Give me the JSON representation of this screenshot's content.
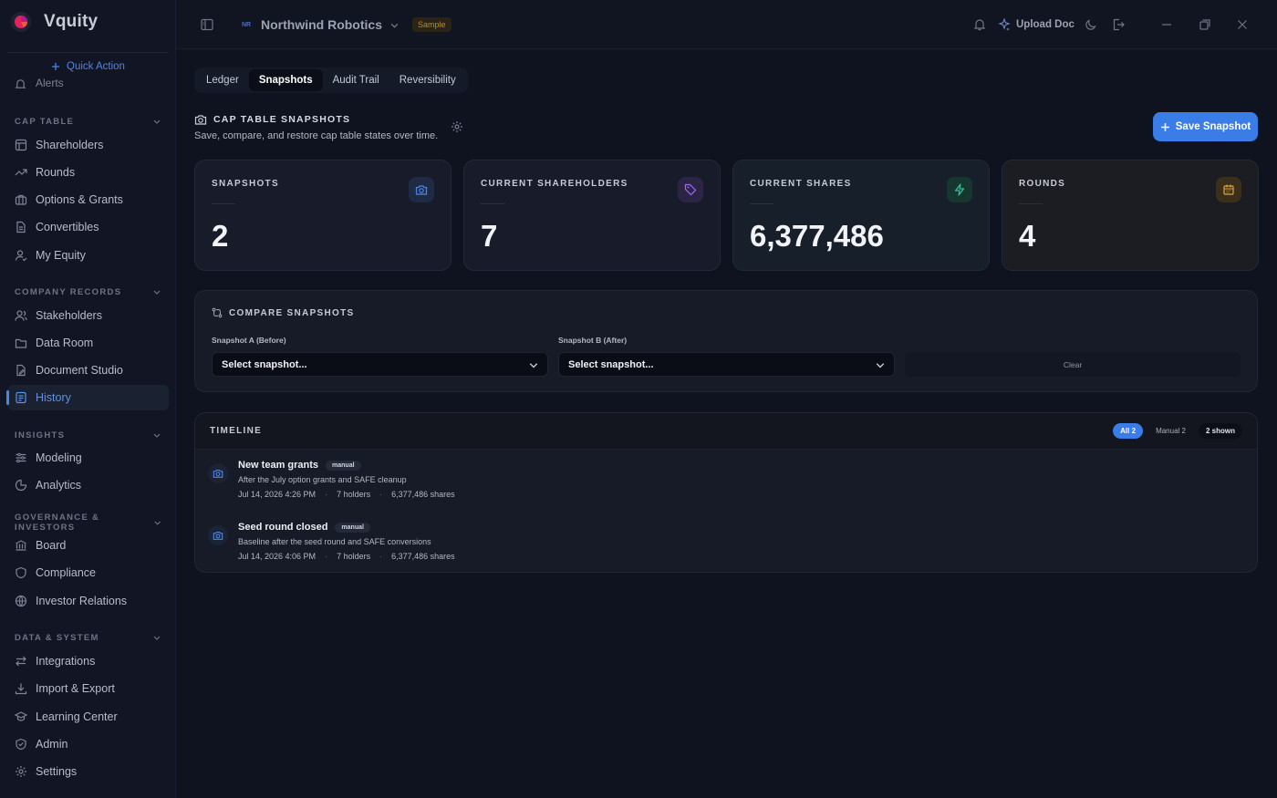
{
  "brand": {
    "name": "Vquity"
  },
  "sidebar": {
    "quick_action": "Quick Action",
    "alerts_peek": "Alerts",
    "sections": [
      {
        "title": "CAP TABLE",
        "items": [
          "Shareholders",
          "Rounds",
          "Options & Grants",
          "Convertibles",
          "My Equity"
        ]
      },
      {
        "title": "COMPANY RECORDS",
        "items": [
          "Stakeholders",
          "Data Room",
          "Document Studio",
          "History"
        ]
      },
      {
        "title": "INSIGHTS",
        "items": [
          "Modeling",
          "Analytics"
        ]
      },
      {
        "title": "GOVERNANCE & INVESTORS",
        "items": [
          "Board",
          "Compliance",
          "Investor Relations"
        ]
      },
      {
        "title": "DATA & SYSTEM",
        "items": [
          "Integrations",
          "Import & Export",
          "Learning Center",
          "Admin",
          "Settings"
        ]
      }
    ],
    "active_item": "History"
  },
  "topbar": {
    "company_initials": "NR",
    "company_name": "Northwind Robotics",
    "badge": "Sample",
    "upload_doc": "Upload Doc"
  },
  "tabs": [
    "Ledger",
    "Snapshots",
    "Audit Trail",
    "Reversibility"
  ],
  "active_tab": "Snapshots",
  "page": {
    "title": "CAP TABLE SNAPSHOTS",
    "subtitle": "Save, compare, and restore cap table states over time.",
    "save_button": "Save Snapshot"
  },
  "stats": [
    {
      "label": "SNAPSHOTS",
      "value": "2",
      "icon": "camera-icon",
      "color": "#4a86e8"
    },
    {
      "label": "CURRENT SHAREHOLDERS",
      "value": "7",
      "icon": "tag-icon",
      "color": "#9b6cf0"
    },
    {
      "label": "CURRENT SHARES",
      "value": "6,377,486",
      "icon": "bolt-icon",
      "color": "#2fc39a"
    },
    {
      "label": "ROUNDS",
      "value": "4",
      "icon": "calendar-icon",
      "color": "#e2a23a"
    }
  ],
  "compare": {
    "title": "COMPARE SNAPSHOTS",
    "label_a": "Snapshot A (Before)",
    "label_b": "Snapshot B (After)",
    "placeholder": "Select snapshot...",
    "clear": "Clear"
  },
  "timeline": {
    "title": "TIMELINE",
    "filters": [
      "All 2",
      "Manual 2",
      "2 shown"
    ],
    "items": [
      {
        "title": "New team grants",
        "badge": "manual",
        "description": "After the July option grants and SAFE cleanup",
        "date": "Jul 14, 2026 4:26 PM",
        "holders": "7 holders",
        "shares": "6,377,486 shares"
      },
      {
        "title": "Seed round closed",
        "badge": "manual",
        "description": "Baseline after the seed round and SAFE conversions",
        "date": "Jul 14, 2026 4:06 PM",
        "holders": "7 holders",
        "shares": "6,377,486 shares"
      }
    ]
  }
}
